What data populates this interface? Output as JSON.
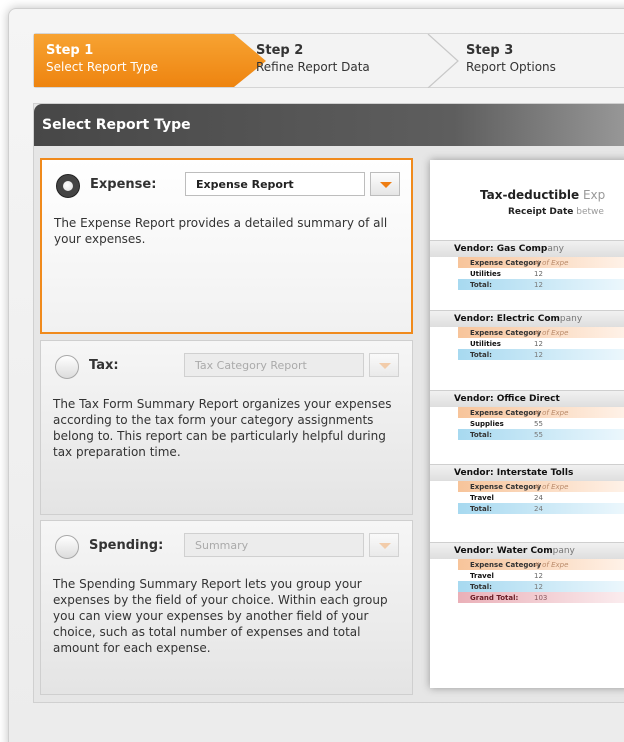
{
  "steps": [
    {
      "num": "Step 1",
      "label": "Select Report Type"
    },
    {
      "num": "Step 2",
      "label": "Refine Report Data"
    },
    {
      "num": "Step 3",
      "label": "Report Options"
    }
  ],
  "panel_title": "Select Report Type",
  "report_types": [
    {
      "title": "Expense:",
      "selected": true,
      "dropdown": "Expense Report",
      "description": "The Expense Report provides a detailed summary of all your expenses."
    },
    {
      "title": "Tax:",
      "selected": false,
      "dropdown": "Tax Category Report",
      "description": "The Tax Form Summary Report organizes your expenses according to the tax form your category assignments belong to. This report can be particularly helpful during tax preparation time."
    },
    {
      "title": "Spending:",
      "selected": false,
      "dropdown": "Summary",
      "description": "The Spending Summary Report lets you group your expenses by the field of your choice. Within each group you can view your expenses by another field of your choice, such as total number of expenses and total amount for each expense."
    }
  ],
  "preview": {
    "title_main": "Tax-deductible",
    "title_fade": " Exp",
    "sub_main": "Receipt Date",
    "sub_fade": " betwe",
    "header_category": "Expense Category",
    "header_count": "# of Expe",
    "total_label": "Total:",
    "vendors": [
      {
        "name_main": "Vendor: Gas Comp",
        "name_fade": "any",
        "category": "Utilities",
        "count": "12",
        "total": "12"
      },
      {
        "name_main": "Vendor: Electric Com",
        "name_fade": "pany",
        "category": "Utilities",
        "count": "12",
        "total": "12"
      },
      {
        "name_main": "Vendor: Office Direct",
        "name_fade": "",
        "category": "Supplies",
        "count": "55",
        "total": "55"
      },
      {
        "name_main": "Vendor: Interstate Tolls",
        "name_fade": "",
        "category": "Travel",
        "count": "24",
        "total": "24"
      },
      {
        "name_main": "Vendor: Water Com",
        "name_fade": "pany",
        "category": "Travel",
        "count": "12",
        "total": "12"
      }
    ],
    "grand_total_label": "Grand Total:",
    "grand_total_value": "103"
  }
}
